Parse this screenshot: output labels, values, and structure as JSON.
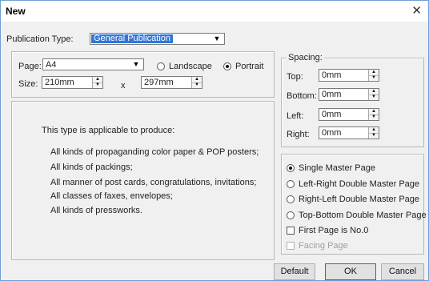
{
  "window": {
    "title": "New",
    "close_glyph": "✕"
  },
  "publication": {
    "label": "Publication Type:",
    "value": "General Publication"
  },
  "page": {
    "label": "Page:",
    "value": "A4",
    "orientation": {
      "landscape_label": "Landscape",
      "portrait_label": "Portrait",
      "selected": "Portrait"
    }
  },
  "size": {
    "label": "Size:",
    "width": "210mm",
    "height": "297mm",
    "separator": "x"
  },
  "spacing": {
    "title": "Spacing:",
    "top_label": "Top:",
    "top_value": "0mm",
    "bottom_label": "Bottom:",
    "bottom_value": "0mm",
    "left_label": "Left:",
    "left_value": "0mm",
    "right_label": "Right:",
    "right_value": "0mm"
  },
  "description": {
    "intro": "This type is applicable to produce:",
    "lines": [
      "All kinds of propaganding color paper & POP posters;",
      "All kinds of packings;",
      "All manner of post cards, congratulations, invitations;",
      "All classes of faxes, envelopes;",
      "All kinds of pressworks."
    ]
  },
  "master": {
    "options": [
      "Single Master Page",
      "Left-Right Double Master Page",
      "Right-Left Double Master Page",
      "Top-Bottom Double Master Page"
    ],
    "selected": "Single Master Page",
    "first_page_label": "First Page is No.0",
    "first_page_checked": false,
    "facing_label": "Facing Page",
    "facing_enabled": false
  },
  "buttons": {
    "default": "Default",
    "ok": "OK",
    "cancel": "Cancel"
  },
  "colors": {
    "selection": "#3275d8",
    "focus_border": "#0078d7",
    "window_border": "#6fa0d6"
  },
  "icons": {
    "dropdown": "▼",
    "spin_up": "▲",
    "spin_down": "▼"
  }
}
